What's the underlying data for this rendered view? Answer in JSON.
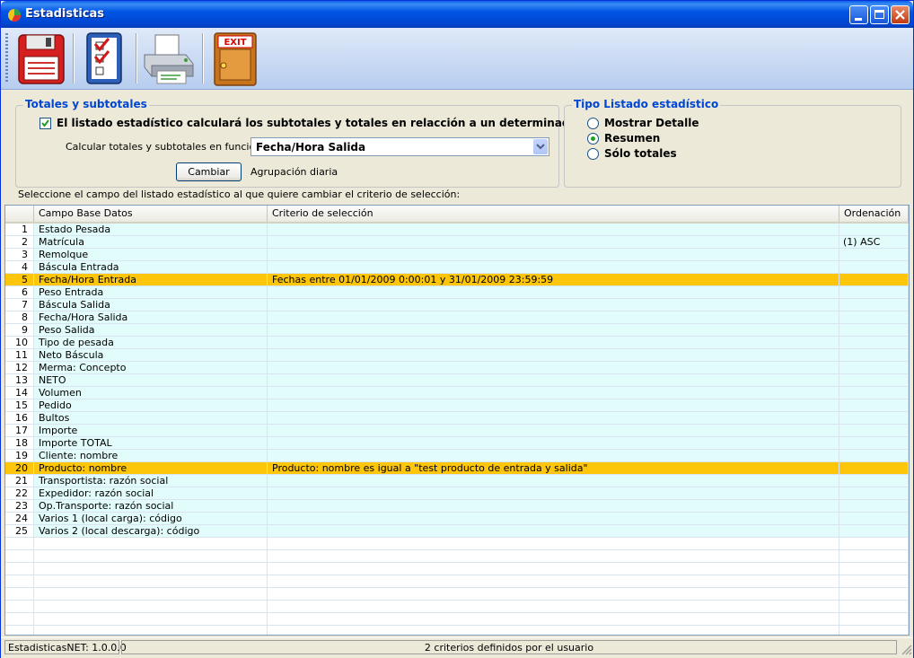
{
  "window": {
    "title": "Estadisticas"
  },
  "toolbar": {
    "buttons": [
      {
        "icon": "floppy-disk-icon"
      },
      {
        "icon": "checklist-icon"
      },
      {
        "icon": "printer-icon"
      },
      {
        "icon": "exit-door-icon",
        "label": "EXIT"
      }
    ]
  },
  "totals": {
    "legend": "Totales y subtotales",
    "checkbox_label": "El listado estadístico calculará los subtotales y totales en relacción a un determinado campo",
    "checked": true,
    "calc_label": "Calcular totales y subtotales en función a:",
    "combo_value": "Fecha/Hora Salida",
    "change_button": "Cambiar",
    "grouping_label": "Agrupación diaria"
  },
  "listing_type": {
    "legend": "Tipo Listado estadístico",
    "options": [
      {
        "label": "Mostrar Detalle",
        "selected": false
      },
      {
        "label": "Resumen",
        "selected": true
      },
      {
        "label": "Sólo totales",
        "selected": false
      }
    ]
  },
  "instruction": "Seleccione el campo del listado estadístico al que quiere cambiar el criterio de selección:",
  "grid": {
    "columns": [
      "",
      "Campo Base Datos",
      "Criterio de selección",
      "Ordenación"
    ],
    "rows": [
      {
        "n": "1",
        "field": "Estado Pesada",
        "criteria": "",
        "order": ""
      },
      {
        "n": "2",
        "field": "Matrícula",
        "criteria": "",
        "order": "(1) ASC"
      },
      {
        "n": "3",
        "field": "Remolque",
        "criteria": "",
        "order": ""
      },
      {
        "n": "4",
        "field": "Báscula Entrada",
        "criteria": "",
        "order": ""
      },
      {
        "n": "5",
        "field": "Fecha/Hora Entrada",
        "criteria": "Fechas entre 01/01/2009 0:00:01 y 31/01/2009 23:59:59",
        "order": "",
        "highlight": true
      },
      {
        "n": "6",
        "field": "Peso Entrada",
        "criteria": "",
        "order": ""
      },
      {
        "n": "7",
        "field": "Báscula Salida",
        "criteria": "",
        "order": ""
      },
      {
        "n": "8",
        "field": "Fecha/Hora Salida",
        "criteria": "",
        "order": ""
      },
      {
        "n": "9",
        "field": "Peso Salida",
        "criteria": "",
        "order": ""
      },
      {
        "n": "10",
        "field": "Tipo de pesada",
        "criteria": "",
        "order": ""
      },
      {
        "n": "11",
        "field": "Neto Báscula",
        "criteria": "",
        "order": ""
      },
      {
        "n": "12",
        "field": "Merma: Concepto",
        "criteria": "",
        "order": ""
      },
      {
        "n": "13",
        "field": "NETO",
        "criteria": "",
        "order": ""
      },
      {
        "n": "14",
        "field": "Volumen",
        "criteria": "",
        "order": ""
      },
      {
        "n": "15",
        "field": "Pedido",
        "criteria": "",
        "order": ""
      },
      {
        "n": "16",
        "field": "Bultos",
        "criteria": "",
        "order": ""
      },
      {
        "n": "17",
        "field": "Importe",
        "criteria": "",
        "order": ""
      },
      {
        "n": "18",
        "field": "Importe TOTAL",
        "criteria": "",
        "order": ""
      },
      {
        "n": "19",
        "field": "Cliente: nombre",
        "criteria": "",
        "order": ""
      },
      {
        "n": "20",
        "field": "Producto: nombre",
        "criteria": "Producto: nombre es igual a \"test producto de entrada y salida\"",
        "order": "",
        "highlight": true
      },
      {
        "n": "21",
        "field": "Transportista: razón social",
        "criteria": "",
        "order": ""
      },
      {
        "n": "22",
        "field": "Expedidor: razón social",
        "criteria": "",
        "order": ""
      },
      {
        "n": "23",
        "field": "Op.Transporte: razón social",
        "criteria": "",
        "order": ""
      },
      {
        "n": "24",
        "field": "Varios 1 (local carga): código",
        "criteria": "",
        "order": ""
      },
      {
        "n": "25",
        "field": "Varios 2 (local descarga): código",
        "criteria": "",
        "order": ""
      }
    ],
    "empty_rows": 8
  },
  "status": {
    "version": "EstadisticasNET: 1.0.0.0",
    "message": "2 criterios definidos por el usuario"
  },
  "colors": {
    "highlight": "#fdc60a",
    "row_tint": "#e2fbfb",
    "title_blue": "#0046d5"
  }
}
